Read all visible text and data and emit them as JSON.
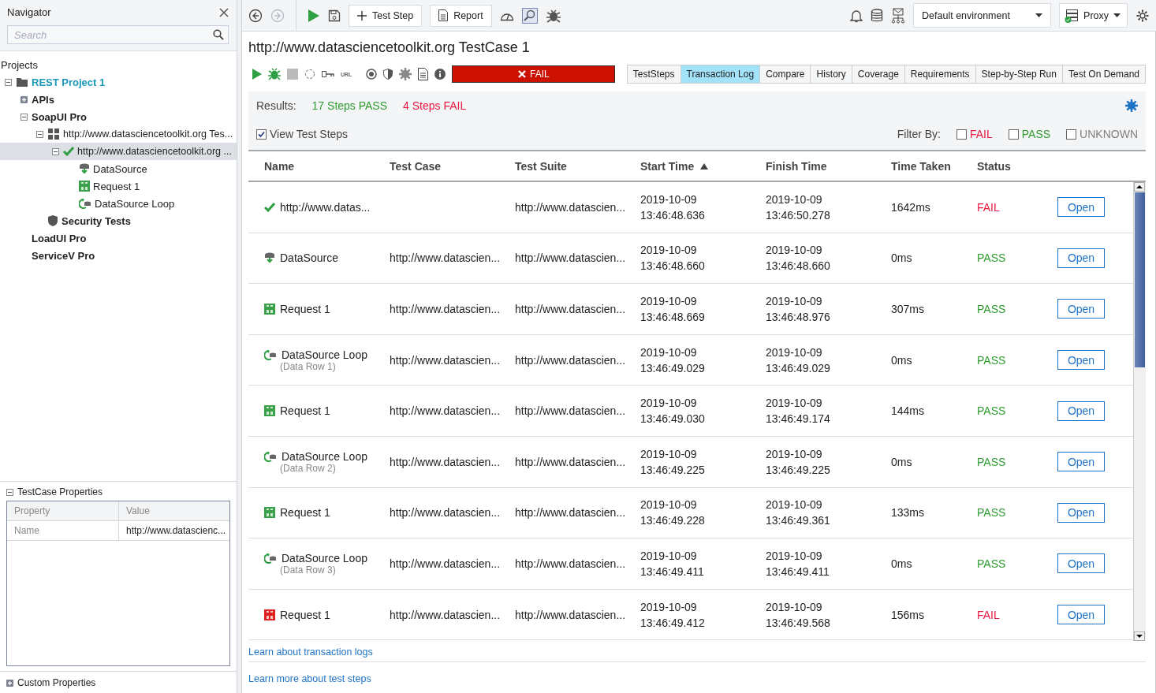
{
  "navigator": {
    "title": "Navigator",
    "search": {
      "placeholder": "Search"
    },
    "section_label": "Projects",
    "tree": [
      {
        "label": "REST Project 1",
        "kind": "project",
        "expanded": true,
        "selected": false,
        "children": [
          {
            "label": "APIs",
            "kind": "module",
            "expanded": false,
            "selected": false
          },
          {
            "label": "SoapUI Pro",
            "kind": "module",
            "expanded": true,
            "selected": false,
            "children": [
              {
                "label": "http://www.datasciencetoolkit.org Tes...",
                "kind": "suite",
                "expanded": true,
                "selected": false,
                "children": [
                  {
                    "label": "http://www.datasciencetoolkit.org ...",
                    "kind": "case",
                    "expanded": true,
                    "selected": true,
                    "children": [
                      {
                        "label": "DataSource",
                        "kind": "datasource",
                        "selected": false
                      },
                      {
                        "label": "Request 1",
                        "kind": "rest-request",
                        "selected": false
                      },
                      {
                        "label": "DataSource Loop",
                        "kind": "datasource-loop",
                        "selected": false
                      }
                    ]
                  }
                ]
              },
              {
                "label": "Security Tests",
                "kind": "security",
                "selected": false
              }
            ]
          },
          {
            "label": "LoadUI Pro",
            "kind": "module",
            "selected": false
          },
          {
            "label": "ServiceV Pro",
            "kind": "module",
            "selected": false
          }
        ]
      }
    ]
  },
  "properties": {
    "title": "TestCase Properties",
    "expanded": true,
    "columns": [
      "Property",
      "Value"
    ],
    "rows": [
      [
        "Name",
        "http://www.datascienc..."
      ]
    ]
  },
  "custom_properties": {
    "title": "Custom Properties",
    "expanded": false
  },
  "toolbar": {
    "nav": [
      {
        "kind": "back",
        "disabled": false
      },
      {
        "kind": "forward",
        "disabled": true
      }
    ],
    "buttons": [
      {
        "label": "Test Step",
        "kind": "add"
      },
      {
        "label": "Report",
        "kind": "report"
      }
    ],
    "environment": "Default environment",
    "proxy": "Proxy"
  },
  "testcase": {
    "title": "http://www.datasciencetoolkit.org TestCase 1",
    "url_label": "URL",
    "run_status": {
      "text": "FAIL",
      "color": "#cc1100"
    },
    "tabs": [
      {
        "label": "TestSteps",
        "selected": false
      },
      {
        "label": "Transaction Log",
        "selected": true
      },
      {
        "label": "Compare",
        "selected": false
      },
      {
        "label": "History",
        "selected": false
      },
      {
        "label": "Coverage",
        "selected": false
      },
      {
        "label": "Requirements",
        "selected": false
      },
      {
        "label": "Step-by-Step Run",
        "selected": false
      },
      {
        "label": "Test On Demand",
        "selected": false
      }
    ]
  },
  "results": {
    "label": "Results:",
    "summary": [
      {
        "text": "17 Steps PASS",
        "color": "#2e9a2e"
      },
      {
        "text": "4 Steps FAIL",
        "color": "#e8173f"
      }
    ],
    "view_steps": {
      "label": "View Test Steps",
      "checked": true
    },
    "filter_label": "Filter By:",
    "filters": [
      {
        "label": "FAIL",
        "checked": false,
        "color": "#e8173f"
      },
      {
        "label": "PASS",
        "checked": false,
        "color": "#2e9a2e"
      },
      {
        "label": "UNKNOWN",
        "checked": false,
        "color": "#808080"
      }
    ]
  },
  "table": {
    "columns": [
      {
        "label": "Name"
      },
      {
        "label": "Test Case"
      },
      {
        "label": "Test Suite"
      },
      {
        "label": "Start Time",
        "sorted_ascending": true
      },
      {
        "label": "Finish Time"
      },
      {
        "label": "Time Taken"
      },
      {
        "label": "Status"
      }
    ],
    "rows": [
      {
        "kind": "testcase-pass",
        "name": "http://www.datas...",
        "test_suite": "http://www.datascien...",
        "start": [
          "2019-10-09",
          "13:46:48.636"
        ],
        "finish": [
          "2019-10-09",
          "13:46:50.278"
        ],
        "time_taken": "1642ms",
        "status": {
          "text": "FAIL",
          "color": "#e8173f"
        },
        "action": "Open"
      },
      {
        "kind": "datasource",
        "name": "DataSource",
        "test_case": "http://www.datascien...",
        "test_suite": "http://www.datascien...",
        "start": [
          "2019-10-09",
          "13:46:48.660"
        ],
        "finish": [
          "2019-10-09",
          "13:46:48.660"
        ],
        "time_taken": "0ms",
        "status": {
          "text": "PASS",
          "color": "#2e9a2e"
        },
        "action": "Open"
      },
      {
        "kind": "rest-request",
        "name": "Request 1",
        "test_case": "http://www.datascien...",
        "test_suite": "http://www.datascien...",
        "start": [
          "2019-10-09",
          "13:46:48.669"
        ],
        "finish": [
          "2019-10-09",
          "13:46:48.976"
        ],
        "time_taken": "307ms",
        "status": {
          "text": "PASS",
          "color": "#2e9a2e"
        },
        "action": "Open"
      },
      {
        "kind": "datasource-loop",
        "name": "DataSource Loop",
        "sub": "(Data Row 1)",
        "test_case": "http://www.datascien...",
        "test_suite": "http://www.datascien...",
        "start": [
          "2019-10-09",
          "13:46:49.029"
        ],
        "finish": [
          "2019-10-09",
          "13:46:49.029"
        ],
        "time_taken": "0ms",
        "status": {
          "text": "PASS",
          "color": "#2e9a2e"
        },
        "action": "Open"
      },
      {
        "kind": "rest-request",
        "name": "Request 1",
        "test_case": "http://www.datascien...",
        "test_suite": "http://www.datascien...",
        "start": [
          "2019-10-09",
          "13:46:49.030"
        ],
        "finish": [
          "2019-10-09",
          "13:46:49.174"
        ],
        "time_taken": "144ms",
        "status": {
          "text": "PASS",
          "color": "#2e9a2e"
        },
        "action": "Open"
      },
      {
        "kind": "datasource-loop",
        "name": "DataSource Loop",
        "sub": "(Data Row 2)",
        "test_case": "http://www.datascien...",
        "test_suite": "http://www.datascien...",
        "start": [
          "2019-10-09",
          "13:46:49.225"
        ],
        "finish": [
          "2019-10-09",
          "13:46:49.225"
        ],
        "time_taken": "0ms",
        "status": {
          "text": "PASS",
          "color": "#2e9a2e"
        },
        "action": "Open"
      },
      {
        "kind": "rest-request",
        "name": "Request 1",
        "test_case": "http://www.datascien...",
        "test_suite": "http://www.datascien...",
        "start": [
          "2019-10-09",
          "13:46:49.228"
        ],
        "finish": [
          "2019-10-09",
          "13:46:49.361"
        ],
        "time_taken": "133ms",
        "status": {
          "text": "PASS",
          "color": "#2e9a2e"
        },
        "action": "Open"
      },
      {
        "kind": "datasource-loop",
        "name": "DataSource Loop",
        "sub": "(Data Row 3)",
        "test_case": "http://www.datascien...",
        "test_suite": "http://www.datascien...",
        "start": [
          "2019-10-09",
          "13:46:49.411"
        ],
        "finish": [
          "2019-10-09",
          "13:46:49.411"
        ],
        "time_taken": "0ms",
        "status": {
          "text": "PASS",
          "color": "#2e9a2e"
        },
        "action": "Open"
      },
      {
        "kind": "rest-request-failed",
        "name": "Request 1",
        "test_case": "http://www.datascien...",
        "test_suite": "http://www.datascien...",
        "start": [
          "2019-10-09",
          "13:46:49.412"
        ],
        "finish": [
          "2019-10-09",
          "13:46:49.568"
        ],
        "time_taken": "156ms",
        "status": {
          "text": "FAIL",
          "color": "#e8173f"
        },
        "action": "Open"
      }
    ]
  },
  "links": [
    "Learn about transaction logs",
    "Learn more about test steps"
  ]
}
